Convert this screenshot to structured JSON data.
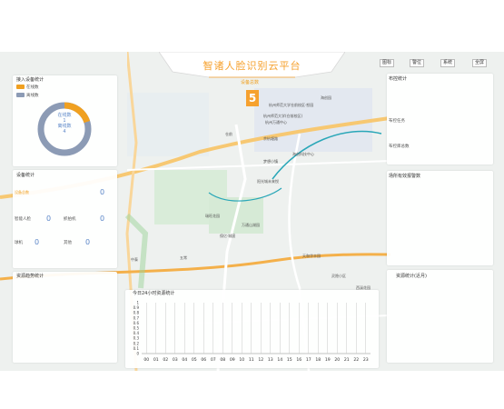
{
  "header": {
    "title": "智诸人脸识别云平台",
    "subtitle": "设备总数",
    "count_badge": "5",
    "buttons": [
      "图标",
      "警位",
      "系统",
      "全屏"
    ]
  },
  "left": {
    "access_title": "接入设备统计",
    "legend": [
      {
        "label": "在线数",
        "color": "#f0a020"
      },
      {
        "label": "离线数",
        "color": "#8c9bb5"
      }
    ],
    "donut": {
      "online_label": "在线数",
      "online_value": "1",
      "offline_label": "离线数",
      "offline_value": "4",
      "online": 1,
      "offline": 4
    },
    "device_title": "设备统计",
    "device_items": [
      {
        "label": "设备总数",
        "value": "0"
      },
      {
        "label": "智能人脸",
        "value": "0"
      },
      {
        "label": "抓拍机",
        "value": "0"
      },
      {
        "label": "球机",
        "value": "0"
      },
      {
        "label": "其他",
        "value": "0"
      }
    ],
    "trend_title": "资源趋势统计"
  },
  "right": {
    "deploy_title": "布控统计",
    "deploy_items": [
      "布控任务",
      "布控库总数"
    ],
    "alarm_title": "场所有效报警数",
    "resource_title": "资源统计(近月)"
  },
  "bottom_chart": {
    "title": "今日24小时资源统计"
  },
  "chart_data": {
    "type": "bar",
    "title": "今日24小时资源统计",
    "categories": [
      "00",
      "01",
      "02",
      "03",
      "04",
      "05",
      "06",
      "07",
      "08",
      "09",
      "10",
      "11",
      "12",
      "13",
      "14",
      "15",
      "16",
      "17",
      "18",
      "19",
      "20",
      "21",
      "22",
      "23"
    ],
    "values": [
      0,
      0,
      0,
      0,
      0,
      0,
      0,
      0,
      0,
      0,
      0,
      0,
      0,
      0,
      0,
      0,
      0,
      0,
      0,
      0,
      0,
      0,
      0,
      0
    ],
    "yticks": [
      "1",
      "0.9",
      "0.8",
      "0.7",
      "0.6",
      "0.5",
      "0.4",
      "0.3",
      "0.2",
      "0.1",
      "0"
    ],
    "ylim": [
      0,
      1
    ]
  },
  "map_labels": [
    "杭州师范大学仓前校区·恕园",
    "杭州师范大学(仓前校区)",
    "海创园",
    "杭州万通中心",
    "仓前",
    "阳光城未来悦",
    "梦想小镇",
    "海创科技中心",
    "余杭塘路",
    "瑞旺花园",
    "万通山湖园",
    "保亿·城宸",
    "天和华丰园",
    "五常",
    "西溪花园",
    "中泰",
    "灵隐小区"
  ]
}
